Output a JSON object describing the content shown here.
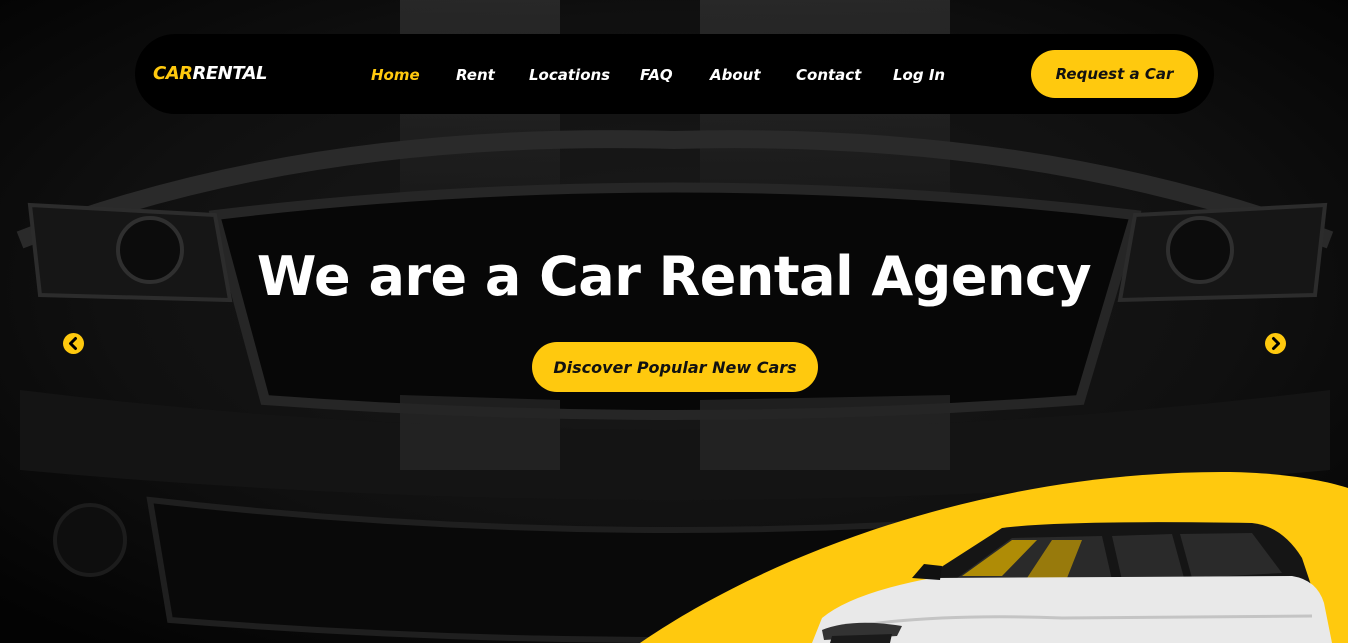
{
  "logo": {
    "part1": "CAR",
    "part2": "RENTAL"
  },
  "nav": {
    "items": [
      {
        "label": "Home",
        "active": true
      },
      {
        "label": "Rent",
        "active": false
      },
      {
        "label": "Locations",
        "active": false
      },
      {
        "label": "FAQ",
        "active": false
      },
      {
        "label": "About",
        "active": false
      },
      {
        "label": "Contact",
        "active": false
      },
      {
        "label": "Log In",
        "active": false
      }
    ],
    "cta_label": "Request a Car"
  },
  "hero": {
    "headline": "We are a Car Rental Agency",
    "cta_label": "Discover Popular New Cars",
    "prev_icon": "chevron-left-icon",
    "next_icon": "chevron-right-icon"
  },
  "colors": {
    "accent": "#ffc90e",
    "background": "#000000",
    "text": "#ffffff"
  }
}
